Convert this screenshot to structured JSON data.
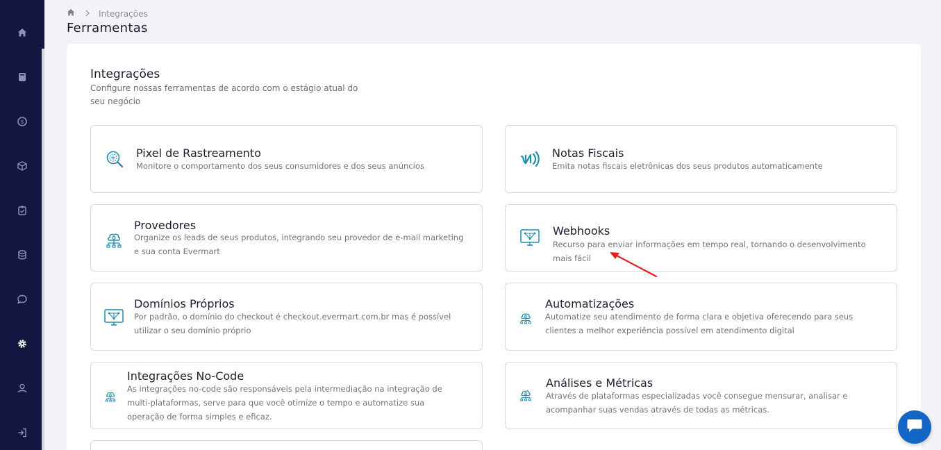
{
  "breadcrumb": {
    "current": "Integrações"
  },
  "page_title": "Ferramentas",
  "section": {
    "title": "Integrações",
    "subtitle": "Configure nossas ferramentas de acordo com o estágio atual do seu negócio"
  },
  "cards": [
    {
      "title": "Pixel de Rastreamento",
      "desc": "Monitore o comportamento dos seus consumidores e dos seus anúncios",
      "icon": "pixel-search-icon"
    },
    {
      "title": "Notas Fiscais",
      "desc": "Emita notas fiscais eletrônicas dos seus produtos automaticamente",
      "icon": "nfe-icon"
    },
    {
      "title": "Provedores",
      "desc": "Organize os leads de seus produtos, integrando seu provedor de e-mail marketing e sua conta Evermart",
      "icon": "cloud-network-icon"
    },
    {
      "title": "Webhooks",
      "desc": "Recurso para enviar informações em tempo real, tornando o desenvolvimento mais fácil",
      "icon": "monitor-network-icon"
    },
    {
      "title": "Domínios Próprios",
      "desc": "Por padrão, o domínio do checkout é checkout.evermart.com.br mas é possível utilizar o seu domínio próprio",
      "icon": "monitor-network-icon"
    },
    {
      "title": "Automatizações",
      "desc": "Automatize seu atendimento de forma clara e objetiva oferecendo para seus clientes a melhor experiência possível em atendimento digital",
      "icon": "cloud-network-icon"
    },
    {
      "title": "Integrações No-Code",
      "desc": "As integrações no-code são responsáveis pela intermediação na integração de multi-plataformas, serve para que você otimize o tempo e automatize sua operação de forma simples e eficaz.",
      "icon": "cloud-network-icon"
    },
    {
      "title": "Análises e Métricas",
      "desc": "Através de plataformas especializadas você consegue mensurar, analisar e acompanhar suas vendas através de todas as métricas.",
      "icon": "cloud-network-icon"
    }
  ],
  "sidebar": {
    "icons": [
      "home-icon",
      "book-icon",
      "dollar-icon",
      "box-icon",
      "clipboard-icon",
      "database-icon",
      "chat-icon",
      "gear-icon",
      "user-icon",
      "logout-icon"
    ]
  },
  "colors": {
    "sidebar": "#13163f",
    "accent": "#1f8fb0",
    "chat": "#1466c6",
    "arrow": "#e02020"
  }
}
